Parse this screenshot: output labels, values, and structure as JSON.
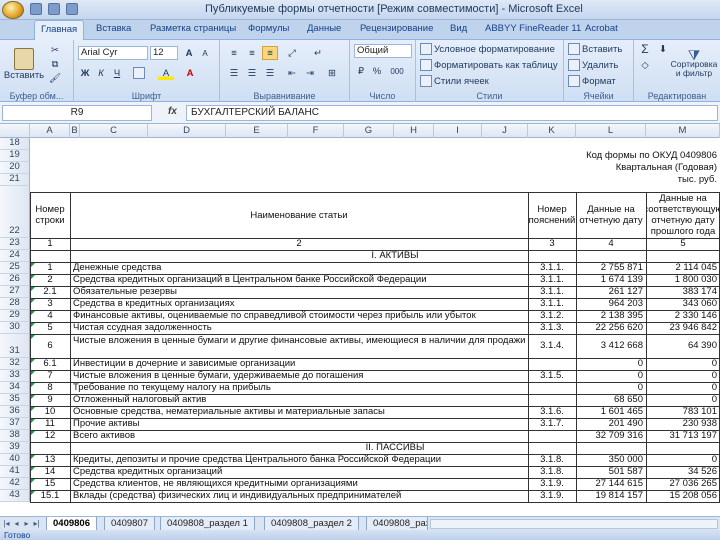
{
  "window": {
    "title": "Публикуемые формы отчетности [Режим совместимости] - Microsoft Excel"
  },
  "ribbon": {
    "tabs": [
      "Главная",
      "Вставка",
      "Разметка страницы",
      "Формулы",
      "Данные",
      "Рецензирование",
      "Вид",
      "ABBYY FineReader 11",
      "Acrobat"
    ],
    "clipboard": {
      "paste_label": "Вставить",
      "group_label": "Буфер обм..."
    },
    "font": {
      "family": "Arial Cyr",
      "size": "12",
      "bold": "Ж",
      "italic": "К",
      "underline": "Ч",
      "grow": "A",
      "shrink": "A",
      "fill": "A",
      "color": "A",
      "group_label": "Шрифт"
    },
    "alignment": {
      "group_label": "Выравнивание"
    },
    "number": {
      "format": "Общий",
      "percent": "%",
      "thousands": "000",
      "group_label": "Число"
    },
    "styles": {
      "cond_label": "Условное форматирование",
      "table_label": "Форматировать как таблицу",
      "cell_styles_label": "Стили ячеек",
      "group_label": "Стили"
    },
    "cells": {
      "insert_label": "Вставить",
      "delete_label": "Удалить",
      "format_label": "Формат",
      "group_label": "Ячейки"
    },
    "editing": {
      "sum": "Σ",
      "sort_label": "Сортировка и фильтр",
      "group_label": "Редактирован"
    }
  },
  "formula_bar": {
    "name_box": "R9",
    "fx": "fx",
    "value": "БУХГАЛТЕРСКИЙ БАЛАНС"
  },
  "columns": [
    "A",
    "B",
    "C",
    "D",
    "E",
    "F",
    "G",
    "H",
    "I",
    "J",
    "K",
    "L",
    "M"
  ],
  "grid": {
    "top_right": [
      "Код формы по ОКУД 0409806",
      "Квартальная (Годовая)",
      "тыс. руб."
    ],
    "header": {
      "col_b": "Номер строки",
      "col_name": "Наименование статьи",
      "col_k": "Номер пояснений",
      "col_l": "Данные на отчетную дату",
      "col_m": "Данные на соответствующую отчетную дату прошлого года"
    },
    "numbering": [
      "1",
      "2",
      "3",
      "4",
      "5"
    ],
    "section_assets": "I. АКТИВЫ",
    "section_liabilities": "II. ПАССИВЫ",
    "rows": [
      {
        "row": "25",
        "b": "1",
        "name": "Денежные средства",
        "k": "3.1.1.",
        "l": "2 755 871",
        "m": "2 114 045"
      },
      {
        "row": "26",
        "b": "2",
        "name": "Средства кредитных организаций в Центральном банке Российской Федерации",
        "k": "3.1.1.",
        "l": "1 674 139",
        "m": "1 800 030"
      },
      {
        "row": "27",
        "b": "2.1",
        "name": "Обязательные резервы",
        "k": "3.1.1.",
        "l": "261 127",
        "m": "383 174"
      },
      {
        "row": "28",
        "b": "3",
        "name": "Средства в кредитных организациях",
        "k": "3.1.1.",
        "l": "964 203",
        "m": "343 060"
      },
      {
        "row": "29",
        "b": "4",
        "name": "Финансовые активы, оцениваемые по справедливой стоимости через прибыль или убыток",
        "k": "3.1.2.",
        "l": "2 138 395",
        "m": "2 330 146"
      },
      {
        "row": "30",
        "b": "5",
        "name": "Чистая ссудная задолженность",
        "k": "3.1.3.",
        "l": "22 256 620",
        "m": "23 946 842"
      },
      {
        "row": "31",
        "b": "6",
        "name": "Чистые вложения в ценные бумаги и другие финансовые активы, имеющиеся в наличии для продажи",
        "k": "3.1.4.",
        "l": "3 412 668",
        "m": "64 390"
      },
      {
        "row": "32",
        "b": "6.1",
        "name": "Инвестиции в дочерние и зависимые организации",
        "k": "",
        "l": "0",
        "m": "0"
      },
      {
        "row": "33",
        "b": "7",
        "name": "Чистые вложения в ценные бумаги, удерживаемые до погашения",
        "k": "3.1.5.",
        "l": "0",
        "m": "0"
      },
      {
        "row": "34",
        "b": "8",
        "name": "Требование по текущему налогу на прибыль",
        "k": "",
        "l": "0",
        "m": "0"
      },
      {
        "row": "35",
        "b": "9",
        "name": "Отложенный налоговый актив",
        "k": "",
        "l": "68 650",
        "m": "0"
      },
      {
        "row": "36",
        "b": "10",
        "name": "Основные средства, нематериальные активы и материальные запасы",
        "k": "3.1.6.",
        "l": "1 601 465",
        "m": "783 101"
      },
      {
        "row": "37",
        "b": "11",
        "name": "Прочие активы",
        "k": "3.1.7.",
        "l": "201 490",
        "m": "230 938"
      },
      {
        "row": "38",
        "b": "12",
        "name": "Всего активов",
        "k": "",
        "l": "32 709 316",
        "m": "31 713 197"
      },
      {
        "row": "40",
        "b": "13",
        "name": "Кредиты, депозиты и прочие средства Центрального банка Российской Федерации",
        "k": "3.1.8.",
        "l": "350 000",
        "m": "0"
      },
      {
        "row": "41",
        "b": "14",
        "name": "Средства кредитных организаций",
        "k": "3.1.8.",
        "l": "501 587",
        "m": "34 526"
      },
      {
        "row": "42",
        "b": "15",
        "name": "Средства клиентов, не являющихся кредитными организациями",
        "k": "3.1.9.",
        "l": "27 144 615",
        "m": "27 036 265"
      },
      {
        "row": "43",
        "b": "15.1",
        "name": "Вклады (средства) физических лиц и индивидуальных предпринимателей",
        "k": "3.1.9.",
        "l": "19 814 157",
        "m": "15 208 056"
      }
    ],
    "row_numbers": {
      "r18": "18",
      "r19": "19",
      "r20": "20",
      "r21": "21",
      "r22": "22",
      "r23": "23",
      "r24": "24",
      "r39": "39"
    }
  },
  "sheet_tabs": [
    "0409806",
    "0409807",
    "0409808_раздел 1",
    "0409808_раздел 2",
    "0409808_раздел 3"
  ],
  "status": "Готово"
}
